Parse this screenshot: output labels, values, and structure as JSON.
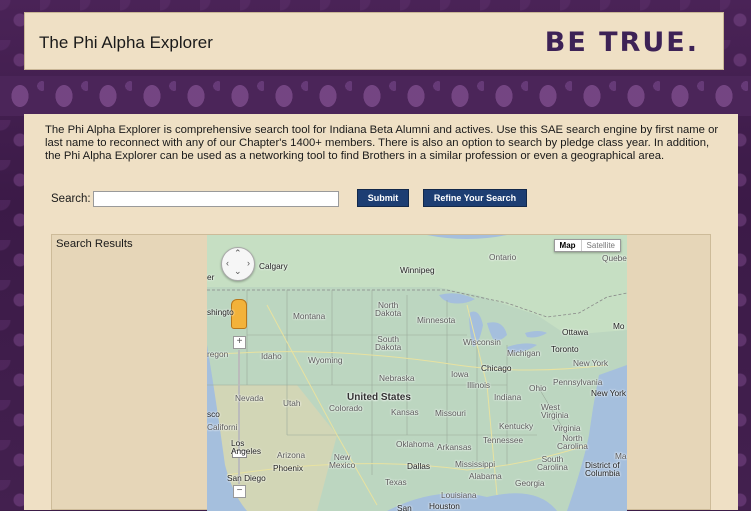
{
  "header": {
    "title": "The Phi Alpha Explorer",
    "logo_text": "BE TRUE."
  },
  "intro": {
    "text": "The Phi Alpha Explorer is comprehensive search tool for Indiana Beta Alumni and actives. Use this SAE search engine by first name or last name to reconnect with any of our Chapter's 1400+ members. There is also an option to search by pledge class year.  In addition, the Phi Alpha Explorer can  be used as a networking tool to find Brothers in a similar profession or even a geographical area."
  },
  "search": {
    "label": "Search:",
    "value": "",
    "placeholder": "",
    "submit_label": "Submit",
    "refine_label": "Refine Your Search"
  },
  "results": {
    "label": "Search Results"
  },
  "map": {
    "type_buttons": [
      "Map",
      "Satellite"
    ],
    "active_type": "Map",
    "pan_arrows": [
      "‹",
      "›",
      "⌃",
      "⌄"
    ],
    "zoom_in": "+",
    "zoom_out": "−",
    "labels": {
      "calgary": "Calgary",
      "winnipeg": "Winnipeg",
      "ontario": "Ontario",
      "quebec": "Quebe",
      "er": "er",
      "washington": "shingto",
      "montana": "Montana",
      "north_dakota": "North\nDakota",
      "minnesota": "Minnesota",
      "ottawa": "Ottawa",
      "mo": "Mo",
      "oregon": "regon",
      "idaho": "Idaho",
      "south_dakota": "South\nDakota",
      "wisconsin": "Wisconsin",
      "michigan": "Michigan",
      "toronto": "Toronto",
      "wyoming": "Wyoming",
      "new_york_state": "New York",
      "chicago": "Chicago",
      "iowa": "Iowa",
      "nebraska": "Nebraska",
      "pennsylvania": "Pennsylvania",
      "illinois": "Illinois",
      "ohio": "Ohio",
      "new_york_city": "New York",
      "nevada": "Nevada",
      "utah": "Utah",
      "united_states": "United States",
      "colorado": "Colorado",
      "indiana": "Indiana",
      "kansas": "Kansas",
      "missouri": "Missouri",
      "west_virginia": "West\nVirginia",
      "sco": "sco",
      "california": "Californi",
      "kentucky": "Kentucky",
      "virginia": "Virginia",
      "tennessee": "Tennessee",
      "north_carolina": "North\nCarolina",
      "oklahoma": "Oklahoma",
      "arkansas": "Arkansas",
      "los_angeles": "Los\nAngeles",
      "arizona": "Arizona",
      "phoenix": "Phoenix",
      "new_mexico": "New\nMexico",
      "mississippi": "Mississippi",
      "south_carolina": "South\nCarolina",
      "ma": "Ma",
      "dallas": "Dallas",
      "alabama": "Alabama",
      "georgia": "Georgia",
      "district_of_columbia": "District of\nColumbia",
      "san_diego": "San Diego",
      "texas": "Texas",
      "louisiana": "Louisiana",
      "houston": "Houston",
      "san": "San"
    }
  },
  "colors": {
    "background_purple": "#3d1d48",
    "panel_tan": "#efe0c5",
    "button_navy": "#1d3e73",
    "logo_purple": "#3d2256",
    "map_land": "#b9d3c0",
    "map_water": "#a5bfdd"
  }
}
